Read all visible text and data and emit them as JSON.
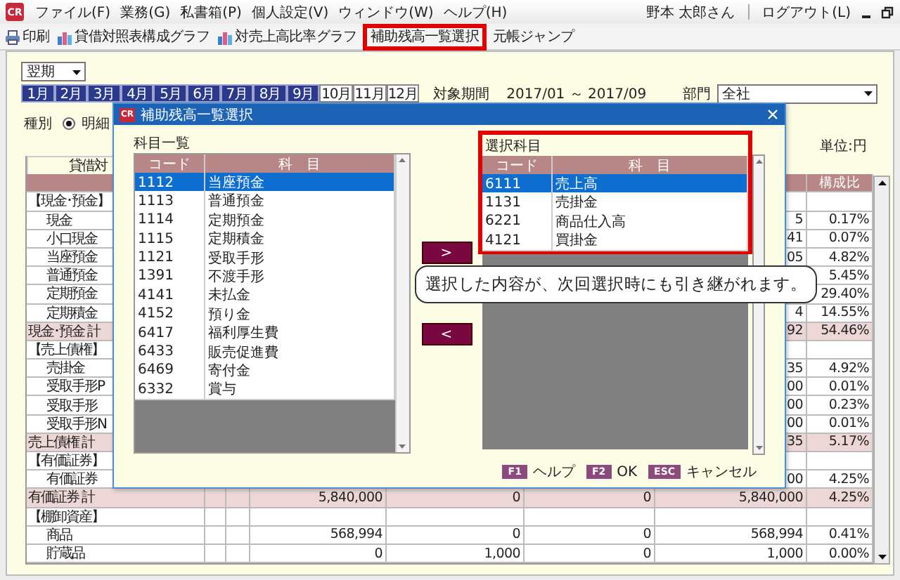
{
  "menu_bar": {
    "logo": "CR",
    "items": [
      "ファイル(F)",
      "業務(G)",
      "私書箱(P)",
      "個人設定(V)",
      "ウィンドウ(W)",
      "ヘルプ(H)"
    ],
    "user": "野本 太郎さん",
    "logout": "ログアウト(L)"
  },
  "toolbar": {
    "items": [
      {
        "label": "印刷",
        "kind": "print",
        "highlighted": false
      },
      {
        "label": "貸借対照表構成グラフ",
        "kind": "chart",
        "highlighted": false
      },
      {
        "label": "対売上高比率グラフ",
        "kind": "chart",
        "highlighted": false
      },
      {
        "label": "補助残高一覧選択",
        "kind": "plain",
        "highlighted": true
      },
      {
        "label": "元帳ジャンプ",
        "kind": "plain",
        "highlighted": false
      }
    ]
  },
  "filters": {
    "term": "翌期",
    "months": [
      {
        "label": "1月",
        "selected": true
      },
      {
        "label": "2月",
        "selected": true
      },
      {
        "label": "3月",
        "selected": true
      },
      {
        "label": "4月",
        "selected": true
      },
      {
        "label": "5月",
        "selected": true
      },
      {
        "label": "6月",
        "selected": true
      },
      {
        "label": "7月",
        "selected": true
      },
      {
        "label": "8月",
        "selected": true
      },
      {
        "label": "9月",
        "selected": true
      },
      {
        "label": "10月",
        "selected": false
      },
      {
        "label": "11月",
        "selected": false
      },
      {
        "label": "12月",
        "selected": false
      }
    ],
    "period_label": "対象期間",
    "period": "2017/01 ～ 2017/09",
    "department_label": "部門",
    "department": "全社",
    "type_label": "種別",
    "type_option": {
      "label": "明細",
      "checked": true
    }
  },
  "report": {
    "title": "貸借対",
    "unit": "単位:円",
    "share_header": "構成比",
    "rows": [
      {
        "kind": "heading",
        "name": "【現金･預金】"
      },
      {
        "kind": "item",
        "name": "現金",
        "amount_4": "5",
        "share": "0.17%"
      },
      {
        "kind": "item",
        "name": "小口現金",
        "amount_4": "41",
        "share": "0.07%"
      },
      {
        "kind": "item",
        "name": "当座預金",
        "amount_4": "05",
        "share": "4.82%"
      },
      {
        "kind": "item",
        "name": "普通預金",
        "share": "5.45%"
      },
      {
        "kind": "item",
        "name": "定期預金",
        "share": "29.40%"
      },
      {
        "kind": "item",
        "name": "定期積金",
        "amount_4": "4",
        "share": "14.55%"
      },
      {
        "kind": "total",
        "name": "現金･預金 計",
        "amount_4": "92",
        "share": "54.46%"
      },
      {
        "kind": "heading",
        "name": "【売上債権】"
      },
      {
        "kind": "item",
        "name": "売掛金",
        "amount_4": "35",
        "share": "4.92%"
      },
      {
        "kind": "item",
        "name": "受取手形P",
        "amount_4": "00",
        "share": "0.01%"
      },
      {
        "kind": "item",
        "name": "受取手形",
        "amount_4": "00",
        "share": "0.23%"
      },
      {
        "kind": "item",
        "name": "受取手形N",
        "amount_4": "00",
        "share": "0.01%"
      },
      {
        "kind": "total",
        "name": "売上債権 計",
        "amount_4": "35",
        "share": "5.17%"
      },
      {
        "kind": "heading",
        "name": "【有価証券】"
      },
      {
        "kind": "item",
        "name": "有価証券",
        "amount_4": "00",
        "share": "4.25%"
      },
      {
        "kind": "total",
        "name": "有価証券 計",
        "amount_1": "5,840,000",
        "amount_2": "0",
        "amount_3": "0",
        "amount_4": "5,840,000",
        "share": "4.25%"
      },
      {
        "kind": "heading",
        "name": "【棚卸資産】"
      },
      {
        "kind": "item",
        "name": "商品",
        "amount_1": "568,994",
        "amount_2": "0",
        "amount_3": "0",
        "amount_4": "568,994",
        "share": "0.41%"
      },
      {
        "kind": "item",
        "name": "貯蔵品",
        "amount_1": "0",
        "amount_2": "1,000",
        "amount_3": "0",
        "amount_4": "1,000",
        "share": "0.00%"
      }
    ]
  },
  "dialog": {
    "logo": "CR",
    "title": "補助残高一覧選択",
    "account_list": {
      "label": "科目一覧",
      "columns": [
        "コード",
        "科　目"
      ],
      "rows": [
        {
          "code": "1112",
          "name": "当座預金",
          "selected": true
        },
        {
          "code": "1113",
          "name": "普通預金",
          "selected": false
        },
        {
          "code": "1114",
          "name": "定期預金",
          "selected": false
        },
        {
          "code": "1115",
          "name": "定期積金",
          "selected": false
        },
        {
          "code": "1121",
          "name": "受取手形",
          "selected": false
        },
        {
          "code": "1391",
          "name": "不渡手形",
          "selected": false
        },
        {
          "code": "4141",
          "name": "未払金",
          "selected": false
        },
        {
          "code": "4152",
          "name": "預り金",
          "selected": false
        },
        {
          "code": "6417",
          "name": "福利厚生費",
          "selected": false
        },
        {
          "code": "6433",
          "name": "販売促進費",
          "selected": false
        },
        {
          "code": "6469",
          "name": "寄付金",
          "selected": false
        },
        {
          "code": "6332",
          "name": "賞与",
          "selected": false
        }
      ]
    },
    "move_right": ">",
    "move_left": "<",
    "selected_list": {
      "label": "選択科目",
      "highlighted": true,
      "columns": [
        "コード",
        "科　目"
      ],
      "rows": [
        {
          "code": "6111",
          "name": "売上高",
          "selected": true
        },
        {
          "code": "1131",
          "name": "売掛金",
          "selected": false
        },
        {
          "code": "6221",
          "name": "商品仕入高",
          "selected": false
        },
        {
          "code": "4121",
          "name": "買掛金",
          "selected": false
        }
      ]
    },
    "footer": [
      {
        "key": "F1",
        "label": "ヘルプ"
      },
      {
        "key": "F2",
        "label": "OK"
      },
      {
        "key": "ESC",
        "label": "キャンセル"
      }
    ]
  },
  "callout": "選択した内容が、次回選択時にも引き継がれます。"
}
